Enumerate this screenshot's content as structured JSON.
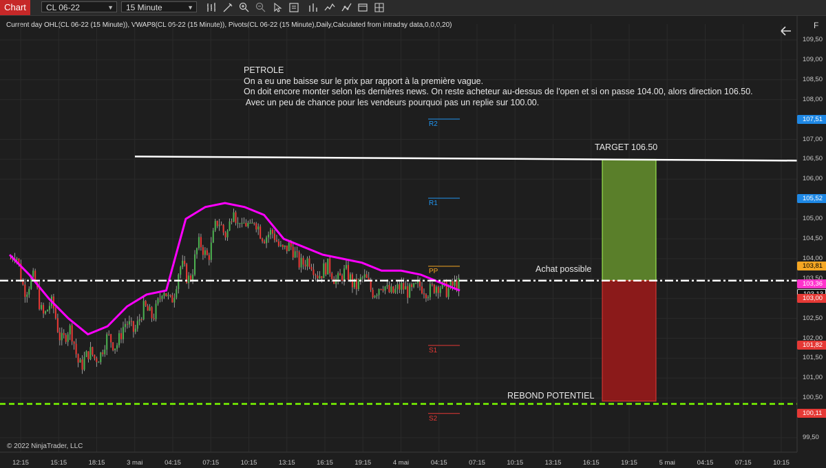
{
  "toolbar": {
    "tab_label": "Chart",
    "instrument": "CL 06-22",
    "interval": "15 Minute"
  },
  "status_line": "Current day OHL(CL 06-22 (15 Minute)), VWAP8(CL 06-22 (15 Minute)), Pivots(CL 06-22 (15 Minute),Daily,Calculated from intraday data,0,0,0,20)",
  "right_panel_label": "F",
  "note_lines": [
    "PETROLE",
    "On a eu une baisse sur le prix par rapport à la première vague.",
    "On doit encore monter selon les dernières news. On reste acheteur au-dessus de l'open et si on passe 104.00, alors direction 106.50.",
    " Avec un peu de chance pour les vendeurs pourquoi pas un replie sur 100.00."
  ],
  "copyright": "© 2022 NinjaTrader, LLC",
  "annotations": {
    "target": "TARGET 106.50",
    "achat": "Achat possible",
    "rebond": "REBOND POTENTIEL"
  },
  "colors": {
    "background": "#1e1e1e",
    "vwap": "#ff00ff",
    "candle_up": "#4caf50",
    "candle_down": "#e53935",
    "target_zone": "#5a7f2a",
    "stop_zone": "#8b1a1a",
    "support_line": "#7cff00",
    "badge_orange": "#f5a623",
    "badge_magenta": "#ff33cc",
    "badge_blue": "#1e88e5",
    "badge_red": "#e53935"
  },
  "chart_data": {
    "type": "candlestick",
    "y_axis": {
      "range": [
        99.2,
        110.2
      ],
      "ticks": [
        "109,50",
        "109,00",
        "108,50",
        "108,00",
        "107,00",
        "106,50",
        "106,00",
        "105,00",
        "104,50",
        "104,00",
        "103,50",
        "103,00",
        "102,50",
        "102,00",
        "101,50",
        "101,00",
        "100,50",
        "99,50"
      ]
    },
    "x_axis": {
      "ticks": [
        "12:15",
        "15:15",
        "18:15",
        "3 mai",
        "04:15",
        "07:15",
        "10:15",
        "13:15",
        "16:15",
        "19:15",
        "4 mai",
        "04:15",
        "07:15",
        "10:15",
        "13:15",
        "16:15",
        "19:15",
        "5 mai",
        "04:15",
        "07:15",
        "10:15"
      ]
    },
    "price_badges": [
      {
        "label": "107,51",
        "value": 107.51,
        "color": "blue"
      },
      {
        "label": "105,52",
        "value": 105.52,
        "color": "blue"
      },
      {
        "label": "103,81",
        "value": 103.81,
        "color": "orange"
      },
      {
        "label": "103,36",
        "value": 103.36,
        "color": "magenta"
      },
      {
        "label": "103,13",
        "value": 103.13,
        "color": "dark"
      },
      {
        "label": "103,00",
        "value": 103.0,
        "color": "red"
      },
      {
        "label": "101,82",
        "value": 101.82,
        "color": "red"
      },
      {
        "label": "100,11",
        "value": 100.11,
        "color": "red"
      }
    ],
    "pivots": [
      {
        "label": "R2",
        "value": 107.51
      },
      {
        "label": "R1",
        "value": 105.52
      },
      {
        "label": "PP",
        "value": 103.81
      },
      {
        "label": "S1",
        "value": 101.82
      },
      {
        "label": "S2",
        "value": 100.11
      }
    ],
    "levels": {
      "target": 106.5,
      "entry": 103.45,
      "support": 100.35
    },
    "segments": [
      [
        104.0,
        104.1,
        100.8,
        101.4
      ],
      [
        101.4,
        103.5,
        101.4,
        102.9
      ],
      [
        102.9,
        106.2,
        102.9,
        105.2
      ],
      [
        105.2,
        104.9,
        103.4,
        103.8
      ],
      [
        103.8,
        104.2,
        102.6,
        103.2
      ],
      [
        103.2,
        103.6,
        102.8,
        103.3
      ]
    ],
    "vwap": [
      104.1,
      103.6,
      103.0,
      102.5,
      102.1,
      102.3,
      102.8,
      103.1,
      103.2,
      105.0,
      105.3,
      105.4,
      105.3,
      105.1,
      104.5,
      104.3,
      104.1,
      104.0,
      103.9,
      103.7,
      103.7,
      103.6,
      103.4,
      103.2
    ]
  }
}
